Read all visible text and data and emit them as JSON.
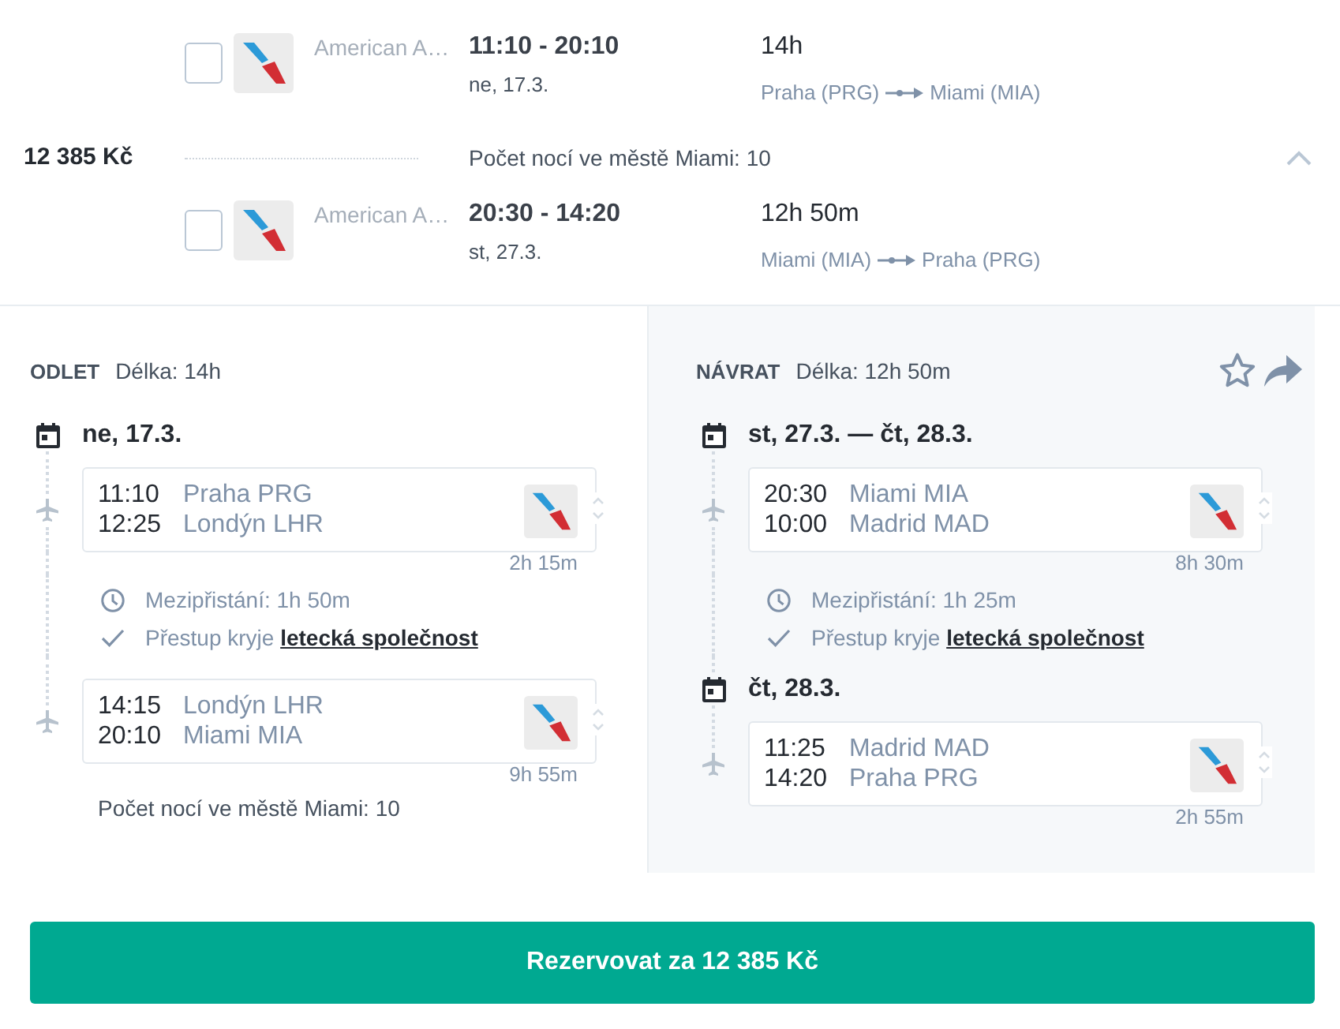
{
  "summary": {
    "flights": [
      {
        "checked": false,
        "airline": "American A…",
        "times": "11:10 - 20:10",
        "date": "ne, 17.3.",
        "duration": "14h",
        "from": "Praha (PRG)",
        "to": "Miami (MIA)"
      },
      {
        "checked": false,
        "airline": "American A…",
        "times": "20:30 - 14:20",
        "date": "st, 27.3.",
        "duration": "12h 50m",
        "from": "Miami (MIA)",
        "to": "Praha (PRG)"
      }
    ],
    "price": "12 385 Kč",
    "nights_note": "Počet nocí ve městě Miami: 10",
    "expanded": true
  },
  "detail": {
    "starred": false,
    "legs": [
      {
        "kind": "outbound",
        "label": "ODLET",
        "length": "Délka: 14h",
        "days": [
          {
            "date": "ne, 17.3.",
            "items": [
              {
                "kind": "flight",
                "dep_time": "11:10",
                "dep_place": "Praha PRG",
                "arr_time": "12:25",
                "arr_place": "Londýn LHR",
                "duration": "2h 15m"
              },
              {
                "kind": "layover",
                "stopover": "Mezipřistání: 1h 50m",
                "transfer_text": "Přestup kryje",
                "transfer_link": "letecká společnost"
              },
              {
                "kind": "flight",
                "dep_time": "14:15",
                "dep_place": "Londýn LHR",
                "arr_time": "20:10",
                "arr_place": "Miami MIA",
                "duration": "9h 55m"
              }
            ]
          }
        ],
        "nights_note": "Počet nocí ve městě Miami: 10"
      },
      {
        "kind": "return",
        "label": "NÁVRAT",
        "length": "Délka: 12h 50m",
        "days": [
          {
            "date": "st, 27.3. — čt, 28.3.",
            "items": [
              {
                "kind": "flight",
                "dep_time": "20:30",
                "dep_place": "Miami MIA",
                "arr_time": "10:00",
                "arr_place": "Madrid MAD",
                "duration": "8h 30m"
              },
              {
                "kind": "layover",
                "stopover": "Mezipřistání: 1h 25m",
                "transfer_text": "Přestup kryje",
                "transfer_link": "letecká společnost"
              }
            ]
          },
          {
            "date": "čt, 28.3.",
            "items": [
              {
                "kind": "flight",
                "dep_time": "11:25",
                "dep_place": "Madrid MAD",
                "arr_time": "14:20",
                "arr_place": "Praha PRG",
                "duration": "2h 55m"
              }
            ]
          }
        ]
      }
    ]
  },
  "book_button": "Rezervovat za 12 385 Kč"
}
